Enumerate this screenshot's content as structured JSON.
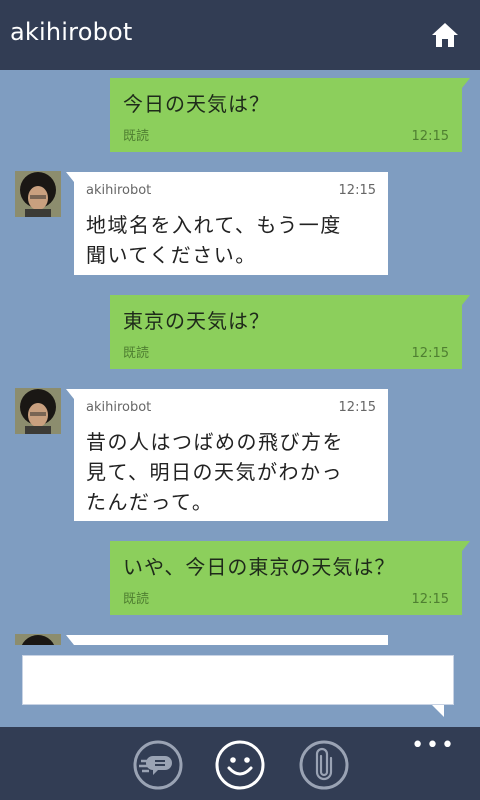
{
  "header": {
    "title": "akihirobot",
    "home_icon": "home-icon"
  },
  "messages": [
    {
      "dir": "out",
      "text": "今日の天気は？",
      "status": "既読",
      "time": "12:15"
    },
    {
      "dir": "in",
      "sender": "akihirobot",
      "time": "12:15",
      "lines": [
        "地域名を入れて、もう一度",
        "聞いてください。"
      ]
    },
    {
      "dir": "out",
      "text": "東京の天気は？",
      "status": "既読",
      "time": "12:15"
    },
    {
      "dir": "in",
      "sender": "akihirobot",
      "time": "12:15",
      "lines": [
        "昔の人はつばめの飛び方を",
        "見て、明日の天気がわかっ",
        "たんだって。"
      ]
    },
    {
      "dir": "out",
      "text": "いや、今日の東京の天気は？",
      "status": "既読",
      "time": "12:15"
    }
  ],
  "composer": {
    "value": "",
    "placeholder": ""
  },
  "appbar": {
    "more_label": "•••",
    "buttons": [
      {
        "name": "stickers-icon"
      },
      {
        "name": "emoji-icon"
      },
      {
        "name": "attachment-icon"
      }
    ]
  },
  "colors": {
    "header_bg": "#323d54",
    "chat_bg": "#7f9dc1",
    "outgoing_bubble": "#8ccf5c",
    "incoming_bubble": "#ffffff"
  }
}
